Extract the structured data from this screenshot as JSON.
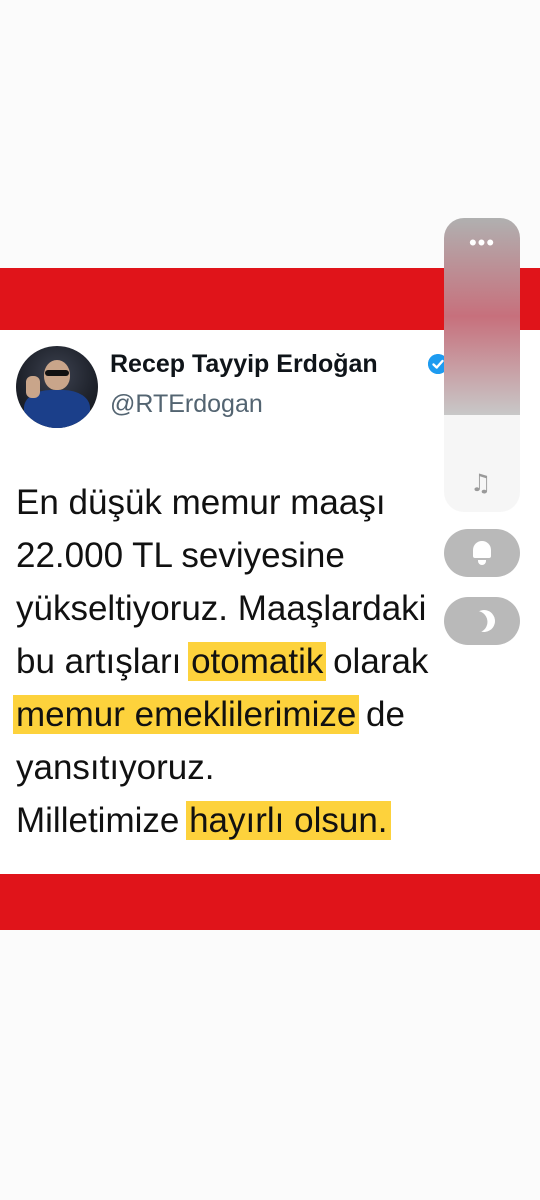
{
  "tweet": {
    "display_name": "Recep Tayyip Erdoğan",
    "username": "@RTErdogan",
    "verified_icon": "verified-badge-icon",
    "lines": [
      {
        "before": "En düşük memur maaşı",
        "highlight": "",
        "after": ""
      },
      {
        "before": "22.000 TL seviyesine",
        "highlight": "",
        "after": ""
      },
      {
        "before": "yükseltiyoruz. Maaşlardaki",
        "highlight": "",
        "after": ""
      },
      {
        "before": "bu artışları ",
        "highlight": "otomatik",
        "after": " olarak"
      },
      {
        "before": "",
        "highlight": "memur emeklilerimize",
        "after": " de"
      },
      {
        "before": "yansıtıyoruz.",
        "highlight": "",
        "after": ""
      },
      {
        "before": "Milletimize ",
        "highlight": "hayırlı olsun.",
        "after": ""
      }
    ],
    "highlight_color": "#fdd23c"
  },
  "banner": {
    "color": "#e0141a"
  },
  "side_panel": {
    "more_label": "•••",
    "volume_level": 0.67,
    "music_icon": "music-note-icon",
    "music_glyph": "♫",
    "bell_icon": "bell-icon",
    "moon_icon": "moon-icon"
  }
}
